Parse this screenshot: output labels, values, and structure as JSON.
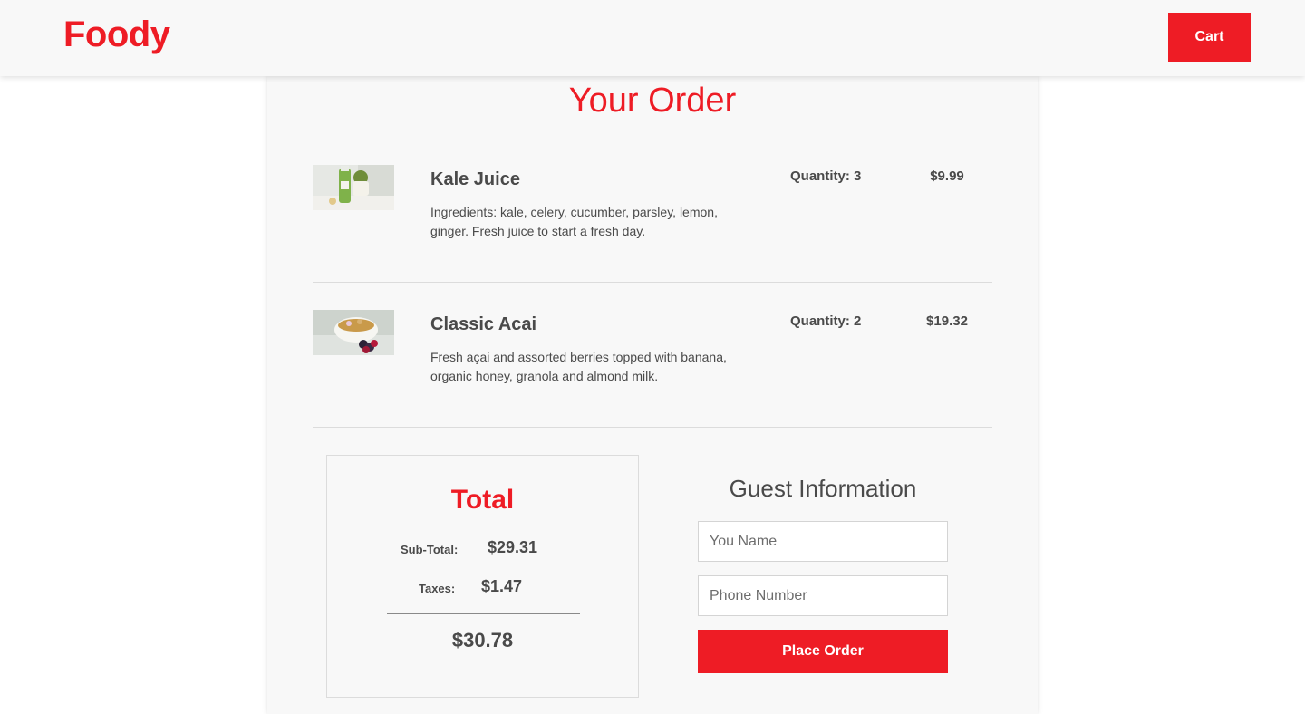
{
  "header": {
    "brand": "Foody",
    "cart_label": "Cart"
  },
  "order": {
    "title": "Your Order",
    "items": [
      {
        "name": "Kale Juice",
        "description": "Ingredients: kale, celery, cucumber, parsley, lemon, ginger. Fresh juice to start a fresh day.",
        "quantity": "Quantity: 3",
        "price": "$9.99"
      },
      {
        "name": "Classic Acai",
        "description": "Fresh açai and assorted berries topped with banana, organic honey, granola and almond milk.",
        "quantity": "Quantity: 2",
        "price": "$19.32"
      }
    ]
  },
  "totals": {
    "title": "Total",
    "subtotal_label": "Sub-Total:",
    "subtotal_value": "$29.31",
    "taxes_label": "Taxes:",
    "taxes_value": "$1.47",
    "grand_total": "$30.78"
  },
  "guest": {
    "title": "Guest Information",
    "name_placeholder": "You Name",
    "phone_placeholder": "Phone Number",
    "submit_label": "Place Order"
  },
  "colors": {
    "accent": "#ee1c25",
    "text": "#4a4a4a",
    "panel": "#f8f8f8"
  }
}
